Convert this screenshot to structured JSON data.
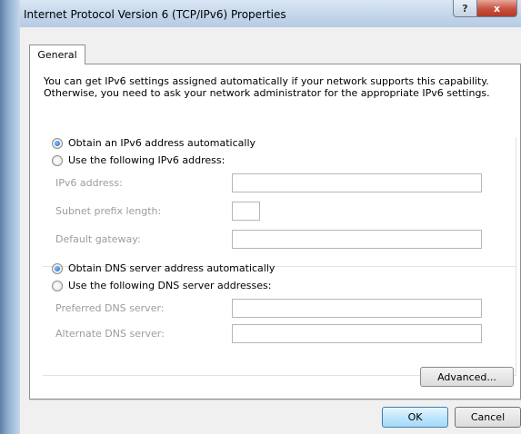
{
  "window": {
    "title": "Internet Protocol Version 6 (TCP/IPv6) Properties",
    "help_glyph": "?",
    "close_glyph": "x"
  },
  "tabs": [
    {
      "label": "General",
      "selected": true
    }
  ],
  "intro": {
    "line1": "You can get IPv6 settings assigned automatically if your network supports this capability.",
    "line2": "Otherwise, you need to ask your network administrator for the appropriate IPv6 settings."
  },
  "ip_section": {
    "auto_label": "Obtain an IPv6 address automatically",
    "manual_label": "Use the following IPv6 address:",
    "selected": "auto",
    "fields": [
      {
        "label": "IPv6 address:",
        "value": ""
      },
      {
        "label": "Subnet prefix length:",
        "value": ""
      },
      {
        "label": "Default gateway:",
        "value": ""
      }
    ]
  },
  "dns_section": {
    "auto_label": "Obtain DNS server address automatically",
    "manual_label": "Use the following DNS server addresses:",
    "selected": "auto",
    "fields": [
      {
        "label": "Preferred DNS server:",
        "value": ""
      },
      {
        "label": "Alternate DNS server:",
        "value": ""
      }
    ]
  },
  "buttons": {
    "advanced": "Advanced...",
    "ok": "OK",
    "cancel": "Cancel"
  },
  "colors": {
    "title_bar": "#c4d6ea",
    "close_button": "#c9503c",
    "ok_button": "#bee6fd"
  }
}
